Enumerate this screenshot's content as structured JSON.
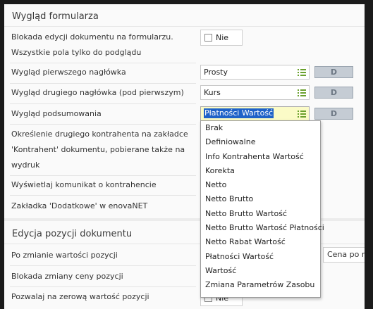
{
  "section1": {
    "title": "Wygląd formularza",
    "rows": {
      "lock": {
        "label_line1": "Blokada edycji dokumentu na formularzu.",
        "label_line2": "Wszystkie pola tylko do podglądu",
        "value": "Nie"
      },
      "header1": {
        "label": "Wygląd pierwszego nagłówka",
        "value": "Prosty",
        "button": "D"
      },
      "header2": {
        "label": "Wygląd drugiego nagłówka (pod pierwszym)",
        "value": "Kurs",
        "button": "D"
      },
      "summary": {
        "label": "Wygląd podsumowania",
        "value": "Płatności Wartość",
        "button": "D"
      },
      "contractor2": {
        "label_line1": "Określenie drugiego kontrahenta na zakładce",
        "label_line2": "'Kontrahent' dokumentu, pobierane także na",
        "label_line3": "wydruk"
      },
      "message": {
        "label": "Wyświetlaj komunikat o kontrahencie"
      },
      "tab": {
        "label": "Zakładka 'Dodatkowe' w enovaNET"
      }
    }
  },
  "section2": {
    "title": "Edycja pozycji dokumentu",
    "rows": {
      "change": {
        "label": "Po zmianie wartości pozycji",
        "value": "Cena po ra"
      },
      "price_lock": {
        "label": "Blokada zmiany ceny pozycji"
      },
      "zero": {
        "label": "Pozwalaj na zerową wartość pozycji",
        "value": "Nie"
      }
    }
  },
  "dropdown": {
    "options": [
      "Brak",
      "Definiowalne",
      "Info Kontrahenta Wartość",
      "Korekta",
      "Netto",
      "Netto Brutto",
      "Netto Brutto Wartość",
      "Netto Brutto Wartość Płatności",
      "Netto Rabat Wartość",
      "Płatności Wartość",
      "Wartość",
      "Zmiana Parametrów Zasobu"
    ]
  },
  "colors": {
    "selection": "#1e62c8",
    "active_field": "#fbfbc7",
    "list_icon": "#6aa02d",
    "d_button": "#c5ccd4"
  }
}
